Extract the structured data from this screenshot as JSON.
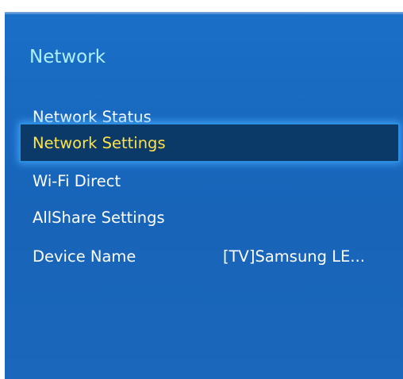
{
  "menu": {
    "title": "Network",
    "items": [
      {
        "label": "Network Status"
      },
      {
        "label": "Network Settings"
      },
      {
        "label": "Wi-Fi Direct"
      },
      {
        "label": "AllShare Settings"
      },
      {
        "label": "Device Name",
        "value": "[TV]Samsung LE..."
      }
    ],
    "selected_index": 1
  },
  "colors": {
    "background": "#1a6fc7",
    "title": "#aef0ff",
    "text": "#ffffff",
    "selected_text": "#ffe24a",
    "selected_background": "#0b3a69",
    "selected_glow": "#2a8de0"
  }
}
